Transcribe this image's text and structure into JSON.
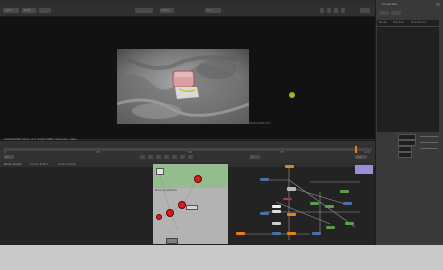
{
  "menu": [
    "File",
    "Edit",
    "Render",
    "Cache",
    "Help"
  ],
  "toolbar": {
    "frame_field": "0:0",
    "viewer_mode": "RGB",
    "channel": "rgba",
    "zoom": "100%"
  },
  "viewer": {
    "status": "1920x1080 bbox: 0 0 1920 1080 channels: rgba",
    "format_label": "1920x1080 HD"
  },
  "properties": {
    "title": "Properties",
    "tabs": [
      "Node",
      "Tracker",
      "Transform"
    ]
  },
  "timeline": {
    "start": "1",
    "end": "100",
    "fps": "24",
    "ticks": [
      "1",
      "25",
      "50",
      "75",
      "100"
    ]
  },
  "nodegraph": {
    "tabs": [
      "Node Graph",
      "Curve Editor",
      "Dope Sheet"
    ],
    "backdrop_label": "BackdropNode"
  },
  "colors": {
    "accent": "#e8801a",
    "node_green": "#5a9e4a",
    "node_blue": "#4b6fa8",
    "backdrop_green": "#93bd8c",
    "track_point": "#a8b21c"
  }
}
